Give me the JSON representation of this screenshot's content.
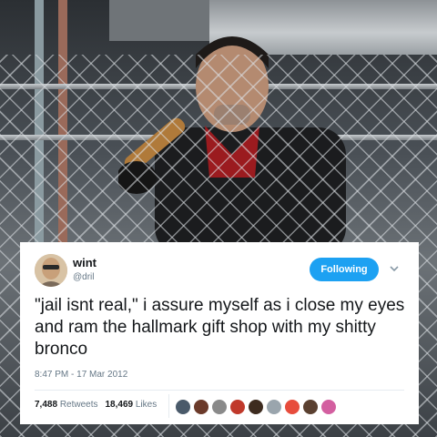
{
  "tweet": {
    "display_name": "wint",
    "handle": "@dril",
    "follow_label": "Following",
    "text": "\"jail isnt real,\" i assure myself as i close my eyes and ram the hallmark gift shop with my shitty bronco",
    "timestamp": "8:47 PM - 17 Mar 2012",
    "retweet_count": "7,488",
    "retweet_label": "Retweets",
    "like_count": "18,469",
    "like_label": "Likes",
    "liker_colors": [
      "#4a5a6a",
      "#6b3a2a",
      "#8a8a8a",
      "#c0392b",
      "#3d2b1f",
      "#9aa5ad",
      "#e74c3c",
      "#5a4030",
      "#d35fa0"
    ]
  },
  "colors": {
    "accent": "#1da1f2",
    "text": "#14171a",
    "secondary": "#657786"
  }
}
